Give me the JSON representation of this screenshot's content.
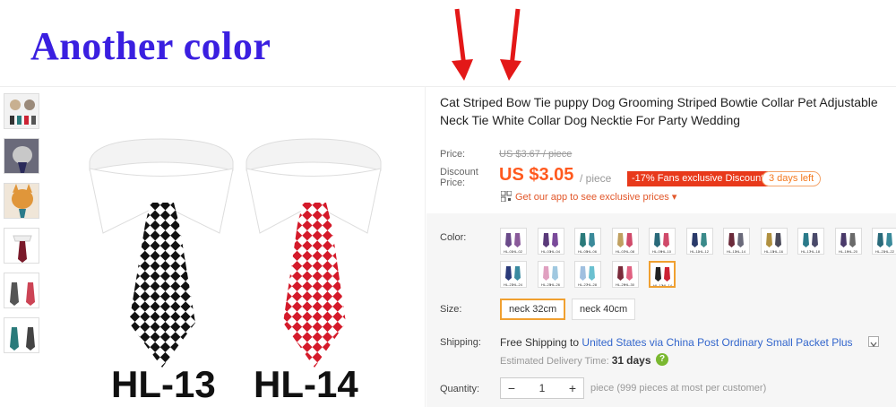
{
  "banner": {
    "title": "Another color"
  },
  "product": {
    "title": "Cat Striped Bow Tie puppy Dog Grooming Striped Bowtie Collar Pet Adjustable Neck Tie White Collar Dog Necktie For Party Wedding",
    "labels": [
      "HL-13",
      "HL-14"
    ]
  },
  "price": {
    "label": "Price:",
    "old": "US $3.67 / piece",
    "discount_label_1": "Discount",
    "discount_label_2": "Price:",
    "current": "US $3.05",
    "per": "/ piece",
    "badge": "-17% Fans exclusive Discount",
    "days_left": "3 days left",
    "app_link": "Get our app to see exclusive prices ▾"
  },
  "color": {
    "label": "Color:",
    "swatches": [
      {
        "codes": [
          "HL-01",
          "HL-02"
        ],
        "ties": [
          "#6a4a8a",
          "#8a5a9a"
        ]
      },
      {
        "codes": [
          "HL-03",
          "HL-04"
        ],
        "ties": [
          "#5a3a7a",
          "#7a4a9a"
        ]
      },
      {
        "codes": [
          "HL-05",
          "HL-06"
        ],
        "ties": [
          "#2a7a7a",
          "#3a8a9a"
        ]
      },
      {
        "codes": [
          "HL-07",
          "HL-08"
        ],
        "ties": [
          "#c0a060",
          "#d04a6a"
        ]
      },
      {
        "codes": [
          "HL-09",
          "HL-10"
        ],
        "ties": [
          "#2a6a7a",
          "#d04a6a"
        ]
      },
      {
        "codes": [
          "HL-11",
          "HL-12"
        ],
        "ties": [
          "#2a3a6a",
          "#3a8a8a"
        ]
      },
      {
        "codes": [
          "HL-13",
          "HL-14"
        ],
        "ties": [
          "#6a2a3a",
          "#6a6a7a"
        ]
      },
      {
        "codes": [
          "HL-15",
          "HL-16"
        ],
        "ties": [
          "#b09040",
          "#4a4a5a"
        ]
      },
      {
        "codes": [
          "HL-17",
          "HL-18"
        ],
        "ties": [
          "#2a7a8a",
          "#4a4a6a"
        ]
      },
      {
        "codes": [
          "HL-19",
          "HL-20"
        ],
        "ties": [
          "#4a3a6a",
          "#6a6a6a"
        ]
      },
      {
        "codes": [
          "HL-21",
          "HL-22"
        ],
        "ties": [
          "#2a6a7a",
          "#3a8a9a"
        ]
      },
      {
        "codes": [
          "HL-23",
          "HL-24"
        ],
        "ties": [
          "#2a3a7a",
          "#3a8aa0"
        ]
      },
      {
        "codes": [
          "HL-25",
          "HL-26"
        ],
        "ties": [
          "#e0a0c0",
          "#a0c8e0"
        ]
      },
      {
        "codes": [
          "HL-27",
          "HL-28"
        ],
        "ties": [
          "#a0c0e0",
          "#6ac0d0"
        ]
      },
      {
        "codes": [
          "HL-29",
          "HL-30"
        ],
        "ties": [
          "#7a2a3a",
          "#e06080"
        ]
      },
      {
        "codes": [
          "HL-13",
          "HL-14"
        ],
        "ties": [
          "#222222",
          "#cc2233"
        ]
      }
    ],
    "selected_index": 15
  },
  "size": {
    "label": "Size:",
    "options": [
      "neck 32cm",
      "neck 40cm"
    ],
    "selected_index": 0
  },
  "shipping": {
    "label": "Shipping:",
    "free": "Free Shipping to",
    "destination": "United States via China Post Ordinary Small Packet Plus",
    "est_label": "Estimated Delivery Time:",
    "est_days": "31",
    "est_unit": "days",
    "help": "?"
  },
  "quantity": {
    "label": "Quantity:",
    "minus": "−",
    "value": "1",
    "plus": "+",
    "note": "piece (999 pieces at most per customer)"
  },
  "colors": {
    "accent": "#ff5a1f",
    "badge": "#e8391b",
    "banner": "#3a1fe0",
    "arrow": "#e31818",
    "selected_border": "#f0a030"
  }
}
